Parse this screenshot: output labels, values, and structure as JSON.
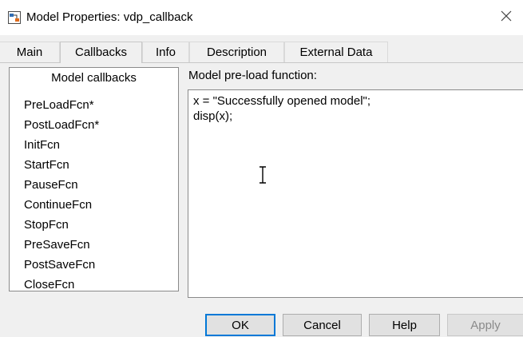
{
  "window": {
    "title": "Model Properties: vdp_callback",
    "icon": "simulink-model-icon",
    "close_icon": "close-icon"
  },
  "tabs": [
    {
      "label": "Main",
      "active": false
    },
    {
      "label": "Callbacks",
      "active": true
    },
    {
      "label": "Info",
      "active": false
    },
    {
      "label": "Description",
      "active": false
    },
    {
      "label": "External Data",
      "active": false
    }
  ],
  "callbacks": {
    "header": "Model callbacks",
    "items": [
      {
        "label": "PreLoadFcn*"
      },
      {
        "label": "PostLoadFcn*"
      },
      {
        "label": "InitFcn"
      },
      {
        "label": "StartFcn"
      },
      {
        "label": "PauseFcn"
      },
      {
        "label": "ContinueFcn"
      },
      {
        "label": "StopFcn"
      },
      {
        "label": "PreSaveFcn"
      },
      {
        "label": "PostSaveFcn"
      },
      {
        "label": "CloseFcn"
      }
    ]
  },
  "editor": {
    "label": "Model pre-load function:",
    "code": "x = \"Successfully opened model\";\ndisp(x);"
  },
  "buttons": {
    "ok": "OK",
    "cancel": "Cancel",
    "help": "Help",
    "apply": "Apply"
  },
  "colors": {
    "focus_border": "#0078d7",
    "disabled_text": "#8a8a8a"
  }
}
